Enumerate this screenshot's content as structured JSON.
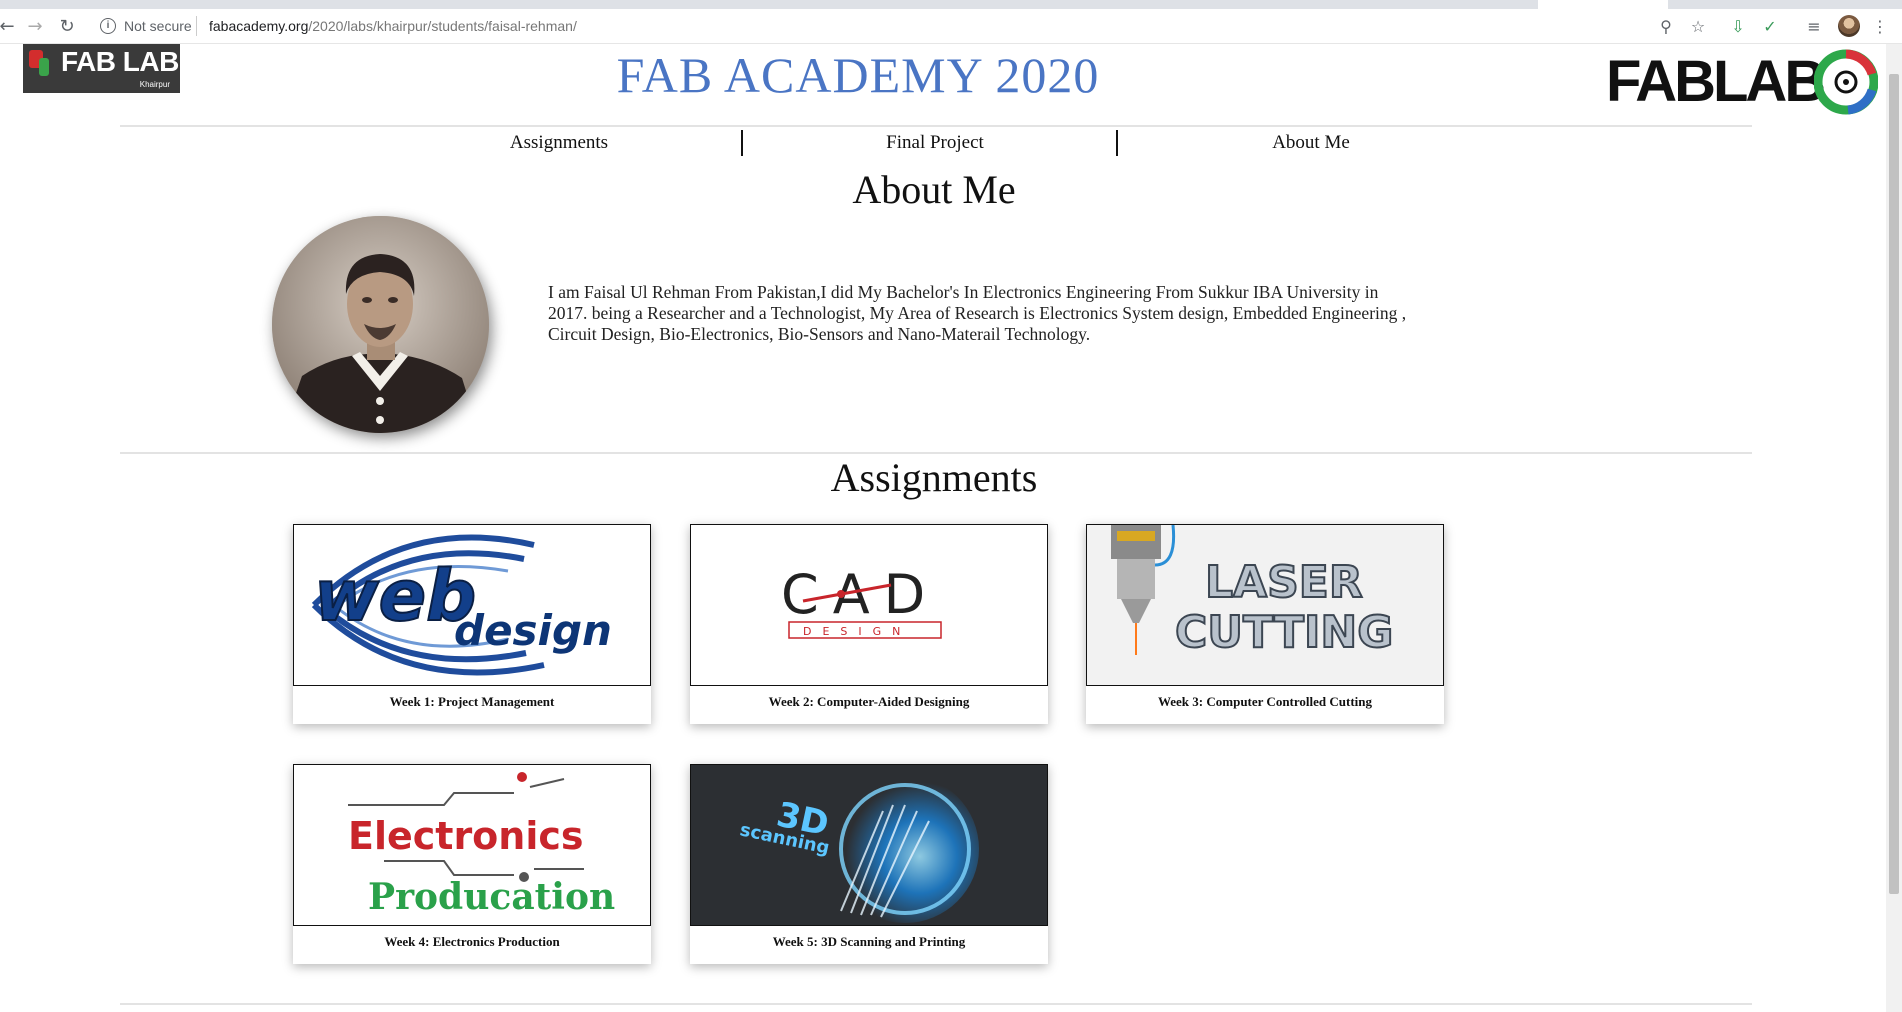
{
  "browser": {
    "security_label": "Not secure",
    "url_host": "fabacademy.org",
    "url_path": "/2020/labs/khairpur/students/faisal-rehman/"
  },
  "header": {
    "left_logo_text": "FAB LAB",
    "left_logo_subtext": "Khairpur",
    "title": "FAB ACADEMY 2020",
    "right_logo_text": "FABLAB",
    "title_color": "#4a75c4"
  },
  "nav": {
    "items": [
      {
        "label": "Assignments"
      },
      {
        "label": "Final Project"
      },
      {
        "label": "About Me"
      }
    ]
  },
  "about": {
    "heading": "About Me",
    "bio": "I am Faisal Ul Rehman From Pakistan,I did My Bachelor's In Electronics Engineering From Sukkur IBA University in 2017. being a Researcher and a Technologist, My Area of  Research is Electronics System design, Embedded Engineering , Circuit Design, Bio-Electronics, Bio-Sensors and Nano-Materail Technology."
  },
  "assignments": {
    "heading": "Assignments",
    "cards": [
      {
        "caption": "Week 1: Project Management",
        "art_text_1": "web",
        "art_text_2": "design"
      },
      {
        "caption": "Week 2: Computer-Aided Designing",
        "art_text_1": "CAD",
        "art_text_2": "DESIGN"
      },
      {
        "caption": "Week 3: Computer Controlled Cutting",
        "art_text_1": "LASER",
        "art_text_2": "CUTTING"
      },
      {
        "caption": "Week 4: Electronics Production",
        "art_text_1": "Electronics",
        "art_text_2": "Producation"
      },
      {
        "caption": "Week 5: 3D Scanning and Printing",
        "art_text_1": "3D",
        "art_text_2": "scanning"
      }
    ]
  }
}
